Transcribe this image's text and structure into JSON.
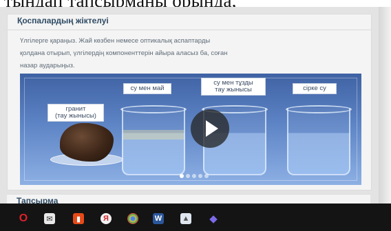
{
  "top_caption": "тындап тапсырманы орында,",
  "card": {
    "title": "Қоспалардың жіктелуі",
    "body_line1": "Үлгілерге қараңыз. Жай көзбен немесе оптикалық аспаптарды",
    "body_line2": "қолдана отырып, үлгілердің компоненттерін айыра аласыз ба, соған",
    "body_line3": "назар аударыңыз."
  },
  "media": {
    "labels": {
      "oil": "су мен май",
      "salt_line1": "су мен тұзды",
      "salt_line2": "тау жынысы",
      "vinegar": "сірке су",
      "granite_line1": "гранит",
      "granite_line2": "(тау жынысы)"
    },
    "slides_total": 5,
    "slide_active": 1
  },
  "task": {
    "title": "Тапсырма"
  },
  "taskbar": {
    "icons": [
      "opera-icon",
      "mail-icon",
      "files-icon",
      "yandex-icon",
      "chrome-icon",
      "word-icon",
      "photos-icon",
      "paint-icon"
    ],
    "glyphs": {
      "opera": "O",
      "mail": "✉",
      "files": "▮",
      "yandex": "Я",
      "chrome": "",
      "word": "W",
      "photos": "▲",
      "paint": "◆"
    }
  }
}
